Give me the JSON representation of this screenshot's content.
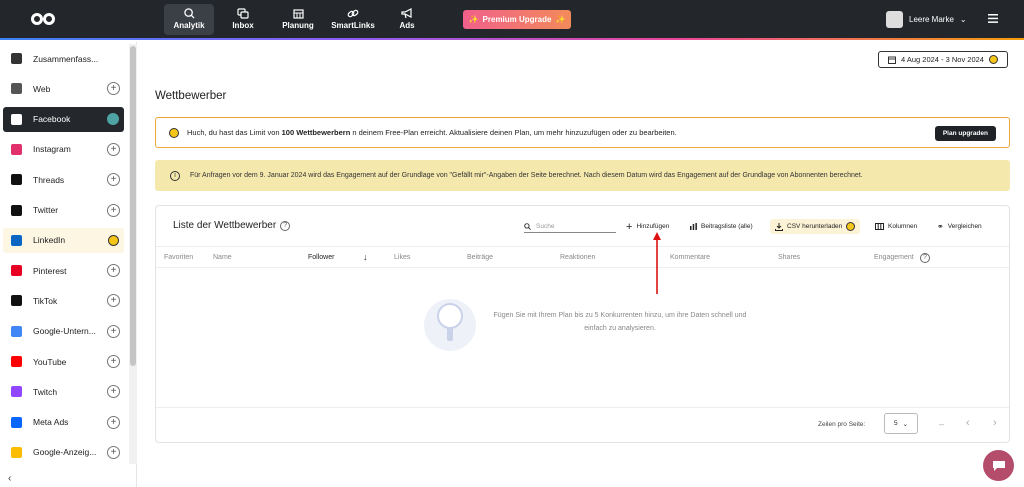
{
  "nav": {
    "items": [
      {
        "label": "Analytik",
        "icon": "analytics-icon",
        "active": true
      },
      {
        "label": "Inbox",
        "icon": "inbox-icon"
      },
      {
        "label": "Planung",
        "icon": "calendar-icon"
      },
      {
        "label": "SmartLinks",
        "icon": "link-icon"
      },
      {
        "label": "Ads",
        "icon": "megaphone-icon"
      }
    ],
    "premium_label": "Premium Upgrade",
    "user_name": "Leere Marke"
  },
  "sidebar": {
    "items": [
      {
        "label": "Zusammenfass...",
        "icon": "clipboard-icon",
        "color": "#333333"
      },
      {
        "label": "Web",
        "icon": "rss-icon",
        "color": "#555555"
      },
      {
        "label": "Facebook",
        "icon": "facebook-icon",
        "color": "#1877f2",
        "active": true
      },
      {
        "label": "Instagram",
        "icon": "instagram-icon",
        "color": "#e1306c"
      },
      {
        "label": "Threads",
        "icon": "threads-icon",
        "color": "#111111"
      },
      {
        "label": "Twitter",
        "icon": "x-icon",
        "color": "#111111"
      },
      {
        "label": "LinkedIn",
        "icon": "linkedin-icon",
        "color": "#0a66c2",
        "locked": true
      },
      {
        "label": "Pinterest",
        "icon": "pinterest-icon",
        "color": "#e60023"
      },
      {
        "label": "TikTok",
        "icon": "tiktok-icon",
        "color": "#111111"
      },
      {
        "label": "Google-Untern...",
        "icon": "google-business-icon",
        "color": "#4285f4"
      },
      {
        "label": "YouTube",
        "icon": "youtube-icon",
        "color": "#ff0000"
      },
      {
        "label": "Twitch",
        "icon": "twitch-icon",
        "color": "#9146ff"
      },
      {
        "label": "Meta Ads",
        "icon": "meta-icon",
        "color": "#0866ff"
      },
      {
        "label": "Google-Anzeig...",
        "icon": "google-ads-icon",
        "color": "#fbbc04"
      }
    ]
  },
  "date_range": "4 Aug 2024 - 3 Nov 2024",
  "page_title": "Wettbewerber",
  "banner_limit": {
    "text_before": "Huch, du hast das Limit von ",
    "text_bold": "100 Wettbewerbern",
    "text_after": " n deinem Free-Plan erreicht. Aktualisiere deinen Plan, um mehr hinzuzufügen oder zu bearbeiten.",
    "button": "Plan upgraden"
  },
  "banner_info": "Für Anfragen vor dem 9. Januar 2024 wird das Engagement auf der Grundlage von \"Gefällt mir\"-Angaben der Seite berechnet. Nach diesem Datum wird das Engagement auf der Grundlage von Abonnenten berechnet.",
  "card": {
    "title": "Liste der Wettbewerber",
    "search_placeholder": "Suche",
    "tools": {
      "add": "Hinzufügen",
      "post_list": "Beitragsliste (alle)",
      "csv": "CSV herunterladen",
      "columns": "Kolumnen",
      "compare": "Vergleichen"
    },
    "columns": [
      "Favoriten",
      "Name",
      "Follower",
      "Likes",
      "Beiträge",
      "Reaktionen",
      "Kommentare",
      "Shares",
      "Engagement"
    ],
    "empty_text": "Fügen Sie mit Ihrem Plan bis zu 5 Konkurrenten hinzu, um ihre Daten schnell und einfach zu analysieren.",
    "per_page_label": "Zeilen pro Seite:",
    "per_page_value": "5"
  }
}
